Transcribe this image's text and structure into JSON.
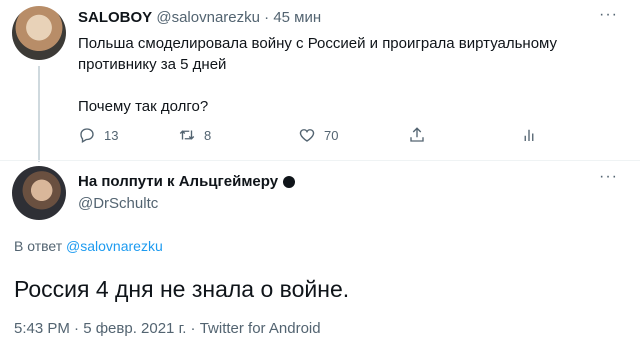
{
  "tweet": {
    "author_name": "SALOBOY",
    "author_handle": "@salovnarezku",
    "separator": "·",
    "time": "45 мин",
    "text_line1": "Польша смоделировала войну с Россией и проиграла виртуальному противнику за 5 дней",
    "text_line2": "Почему так долго?",
    "actions": {
      "replies": "13",
      "retweets": "8",
      "likes": "70"
    },
    "more_label": "···"
  },
  "reply": {
    "author_name": "На полпути к Альцгеймеру",
    "author_handle": "@DrSchultc",
    "more_label": "···",
    "reply_prefix": "В ответ",
    "reply_to_handle": "@salovnarezku",
    "text": "Россия 4 дня не знала о войне.",
    "footer": "5:43 PM · 5 февр. 2021 г. · Twitter for Android"
  },
  "icons": {
    "reply": "reply-icon",
    "retweet": "retweet-icon",
    "like": "heart-icon",
    "share": "share-icon",
    "analytics": "analytics-icon"
  },
  "colors": {
    "link": "#1d9bf0",
    "secondary_text": "#536471",
    "primary_text": "#0f1419"
  }
}
